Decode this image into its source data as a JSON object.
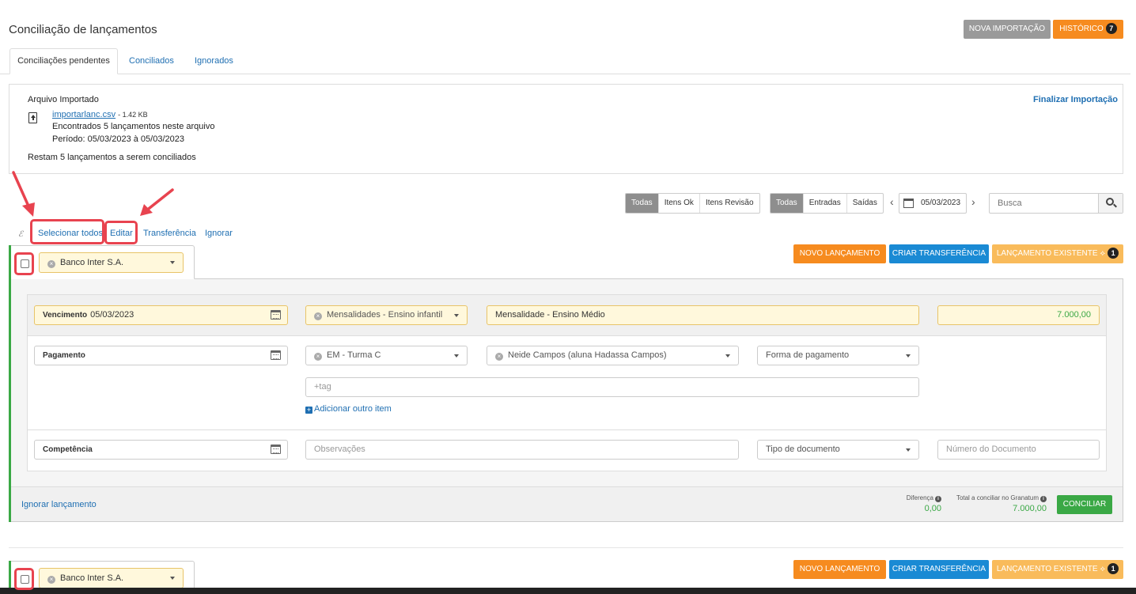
{
  "header": {
    "title": "Conciliação de lançamentos",
    "btn_nova_importacao": "NOVA IMPORTAÇÃO",
    "btn_historico": "HISTÓRICO",
    "historico_count": "7"
  },
  "tabs": [
    "Conciliações pendentes",
    "Conciliados",
    "Ignorados"
  ],
  "import_box": {
    "heading": "Arquivo Importado",
    "file_name": "importarlanc.csv",
    "file_size": "- 1.42 KB",
    "found": "Encontrados 5 lançamentos neste arquivo",
    "period": "Período: 05/03/2023 à 05/03/2023",
    "remaining": "Restam 5 lançamentos a serem conciliados",
    "finalize": "Finalizar Importação"
  },
  "filters": {
    "status": [
      "Todas",
      "Itens Ok",
      "Itens Revisão"
    ],
    "type": [
      "Todas",
      "Entradas",
      "Saídas"
    ],
    "date": "05/03/2023",
    "prev": "‹",
    "next": "›",
    "search_placeholder": "Busca"
  },
  "actions": {
    "select_all": "Selecionar todos",
    "edit": "Editar",
    "transfer": "Transferência",
    "ignore": "Ignorar"
  },
  "entry": {
    "bank": "Banco Inter S.A.",
    "btn_novo": "NOVO LANÇAMENTO",
    "btn_transfer": "CRIAR TRANSFERÊNCIA",
    "btn_existente": "LANÇAMENTO EXISTENTE",
    "existente_count": "1",
    "vencimento_label": "Vencimento",
    "vencimento_value": "05/03/2023",
    "category": "Mensalidades - Ensino infantil",
    "description": "Mensalidade - Ensino Médio",
    "amount": "7.000,00",
    "pagamento_label": "Pagamento",
    "cost_center": "EM - Turma C",
    "person": "Neide Campos (aluna Hadassa Campos)",
    "payment_method": "Forma de pagamento",
    "tag_placeholder": "+tag",
    "add_item": "Adicionar outro item",
    "competencia_label": "Competência",
    "obs_placeholder": "Observações",
    "doc_type": "Tipo de documento",
    "doc_number_placeholder": "Número do Documento",
    "ignore_link": "Ignorar lançamento",
    "diff_label": "Diferença",
    "diff_value": "0,00",
    "total_label": "Total a conciliar no Granatum",
    "total_value": "7.000,00",
    "btn_conciliar": "CONCILIAR"
  },
  "entry2": {
    "bank": "Banco Inter S.A.",
    "btn_novo": "NOVO LANÇAMENTO",
    "btn_transfer": "CRIAR TRANSFERÊNCIA",
    "btn_existente": "LANÇAMENTO EXISTENTE",
    "existente_count": "1"
  },
  "colors": {
    "accent_blue": "#1a8ad4",
    "orange": "#f68b1f",
    "light_orange": "#f9bb5b",
    "green": "#3aa845",
    "annotation_red": "#e8434f"
  }
}
